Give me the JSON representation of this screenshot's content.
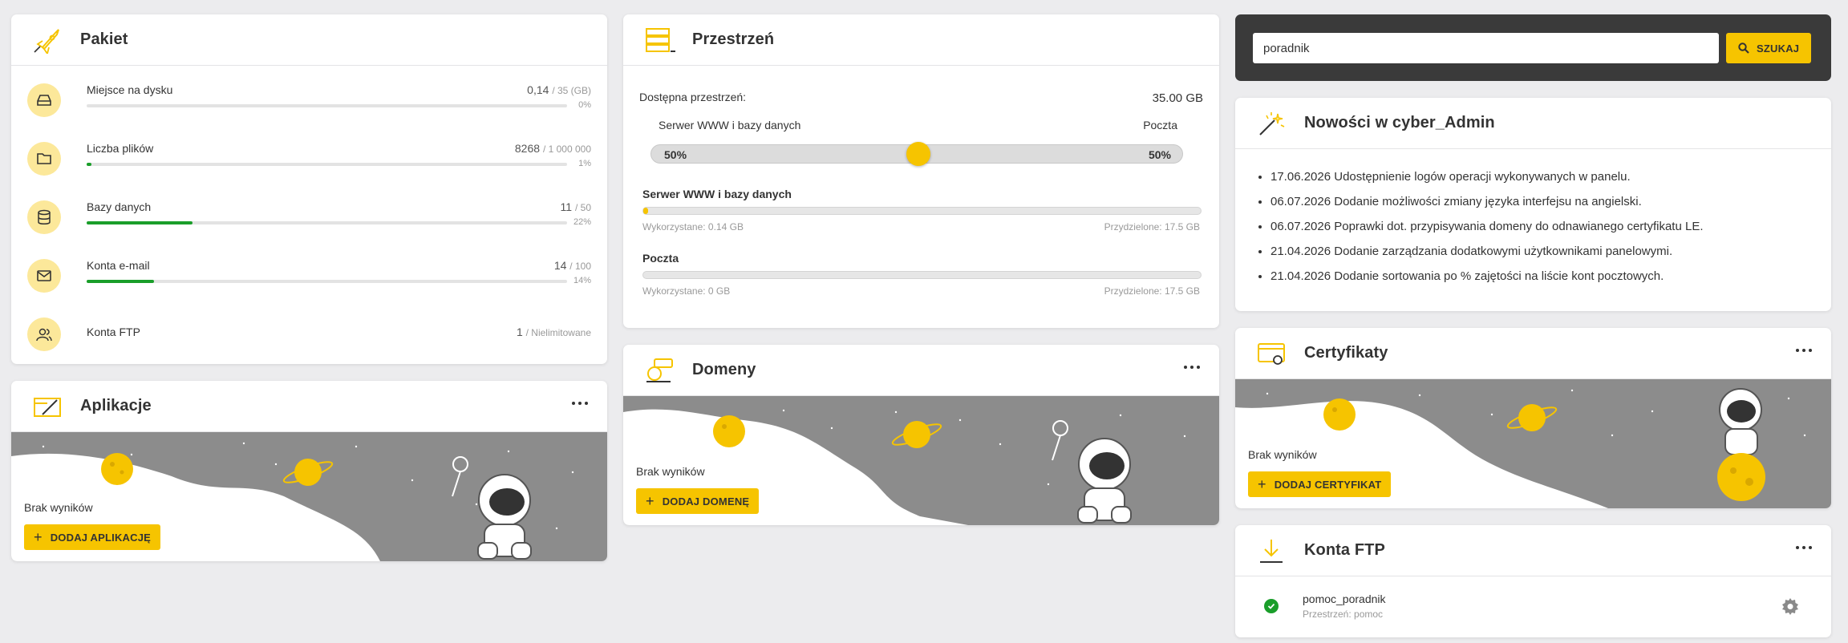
{
  "pakiet": {
    "title": "Pakiet",
    "rows": [
      {
        "label": "Miejsce na dysku",
        "value": "0,14",
        "limit": "/ 35 (GB)",
        "pct": "0%",
        "fill": 0.0
      },
      {
        "label": "Liczba plików",
        "value": "8268",
        "limit": "/ 1 000 000",
        "pct": "1%",
        "fill": 0.01
      },
      {
        "label": "Bazy danych",
        "value": "11",
        "limit": "/ 50",
        "pct": "22%",
        "fill": 0.22
      },
      {
        "label": "Konta e-mail",
        "value": "14",
        "limit": "/ 100",
        "pct": "14%",
        "fill": 0.14
      },
      {
        "label": "Konta FTP",
        "value": "1",
        "limit": "/ Nielimitowane"
      }
    ]
  },
  "aplikacje": {
    "title": "Aplikacje",
    "empty": "Brak wyników",
    "button": "DODAJ APLIKACJĘ"
  },
  "przestrzen": {
    "title": "Przestrzeń",
    "available_label": "Dostępna przestrzeń:",
    "available_value": "35.00 GB",
    "split_left_label": "Serwer WWW i bazy danych",
    "split_right_label": "Poczta",
    "split_left_pct": "50%",
    "split_right_pct": "50%",
    "www_title": "Serwer WWW i bazy danych",
    "www_used": "Wykorzystane: 0.14 GB",
    "www_alloc": "Przydzielone: 17.5 GB",
    "www_fill": 0.008,
    "mail_title": "Poczta",
    "mail_used": "Wykorzystane: 0 GB",
    "mail_alloc": "Przydzielone: 17.5 GB",
    "mail_fill": 0.0
  },
  "domeny": {
    "title": "Domeny",
    "empty": "Brak wyników",
    "button": "DODAJ DOMENĘ"
  },
  "search": {
    "value": "poradnik",
    "button": "SZUKAJ"
  },
  "nowosci": {
    "title": "Nowości w cyber_Admin",
    "items": [
      "17.06.2026 Udostępnienie logów operacji wykonywanych w panelu.",
      "06.07.2026 Dodanie możliwości zmiany języka interfejsu na angielski.",
      "06.07.2026 Poprawki dot. przypisywania domeny do odnawianego certyfikatu LE.",
      "21.04.2026 Dodanie zarządzania dodatkowymi użytkownikami panelowymi.",
      "21.04.2026 Dodanie sortowania po % zajętości na liście kont pocztowych."
    ]
  },
  "certyfikaty": {
    "title": "Certyfikaty",
    "empty": "Brak wyników",
    "button": "DODAJ CERTYFIKAT"
  },
  "ftp": {
    "title": "Konta FTP",
    "account": "pomoc_poradnik",
    "space": "Przestrzeń: pomoc"
  },
  "colors": {
    "accent": "#f6c400",
    "progress": "#1a9e2a",
    "dark": "#3a3a3a",
    "banner": "#8c8c8c"
  }
}
